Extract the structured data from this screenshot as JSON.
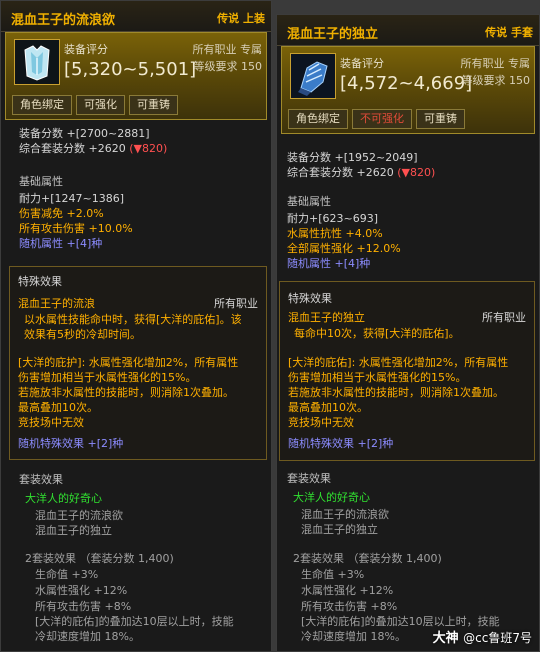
{
  "left": {
    "title": "混血王子的流浪欲",
    "rarity": "传说 上装",
    "score_label": "装备评分",
    "score": "[5,320~5,501]",
    "job": "所有职业 专属",
    "level": "等级要求 150",
    "buttons": [
      "角色绑定",
      "可强化",
      "可重铸"
    ],
    "equip_score": "装备分数 +[2700~2881]",
    "set_score": "综合套装分数 +2620",
    "set_score_delta": "(▼820)",
    "base_header": "基础属性",
    "base": [
      "耐力+[1247~1386]",
      "伤害减免 +2.0%",
      "所有攻击伤害 +10.0%",
      "随机属性 +[4]种"
    ],
    "special_header": "特殊效果",
    "special_name": "混血王子的流浪",
    "special_job": "所有职业",
    "special_desc": [
      "以水属性技能命中时，获得[大洋的庇佑]。该",
      "效果有5秒的冷却时间。"
    ],
    "buff_desc": [
      "[大洋的庇护]: 水属性强化增加2%，所有属性",
      "伤害增加相当于水属性强化的15%。",
      "若施放非水属性的技能时，则消除1次叠加。",
      "最高叠加10次。",
      "竞技场中无效"
    ],
    "random_special": "随机特殊效果 +[2]种",
    "set_header": "套装效果",
    "set_name": "大洋人的好奇心",
    "set_items": [
      "混血王子的流浪欲",
      "混血王子的独立"
    ],
    "set2_title": "2套装效果 （套装分数 1,400)",
    "set2_effects": [
      "生命值 +3%",
      "水属性强化 +12%",
      "所有攻击伤害 +8%",
      "[大洋的庇佑]的叠加达10层以上时，技能",
      "冷却速度增加 18%。"
    ]
  },
  "right": {
    "title": "混血王子的独立",
    "rarity": "传说 手套",
    "score_label": "装备评分",
    "score": "[4,572~4,669]",
    "job": "所有职业 专属",
    "level": "等级要求 150",
    "buttons": [
      "角色绑定",
      "不可强化",
      "可重铸"
    ],
    "equip_score": "装备分数 +[1952~2049]",
    "set_score": "综合套装分数 +2620",
    "set_score_delta": "(▼820)",
    "base_header": "基础属性",
    "base": [
      "耐力+[623~693]",
      "水属性抗性 +4.0%",
      "全部属性强化 +12.0%",
      "随机属性 +[4]种"
    ],
    "special_header": "特殊效果",
    "special_name": "混血王子的独立",
    "special_job": "所有职业",
    "special_desc": [
      "每命中10次，获得[大洋的庇佑]。"
    ],
    "buff_desc": [
      "[大洋的庇佑]: 水属性强化增加2%，所有属性",
      "伤害增加相当于水属性强化的15%。",
      "若施放非水属性的技能时，则消除1次叠加。",
      "最高叠加10次。",
      "竞技场中无效"
    ],
    "random_special": "随机特殊效果 +[2]种",
    "set_header": "套装效果",
    "set_name": "大洋人的好奇心",
    "set_items": [
      "混血王子的流浪欲",
      "混血王子的独立"
    ],
    "set2_title": "2套装效果 （套装分数 1,400)",
    "set2_effects": [
      "生命值 +3%",
      "水属性强化 +12%",
      "所有攻击伤害 +8%",
      "[大洋的庇佑]的叠加达10层以上时，技能",
      "冷却速度增加 18%。"
    ]
  },
  "watermark": {
    "brand": "大神",
    "handle": "@cc鲁班7号"
  },
  "colors": {
    "legendary": "#f0b000",
    "set_green": "#30e030",
    "random_blue": "#8c8cff",
    "negative_red": "#ff5050"
  }
}
